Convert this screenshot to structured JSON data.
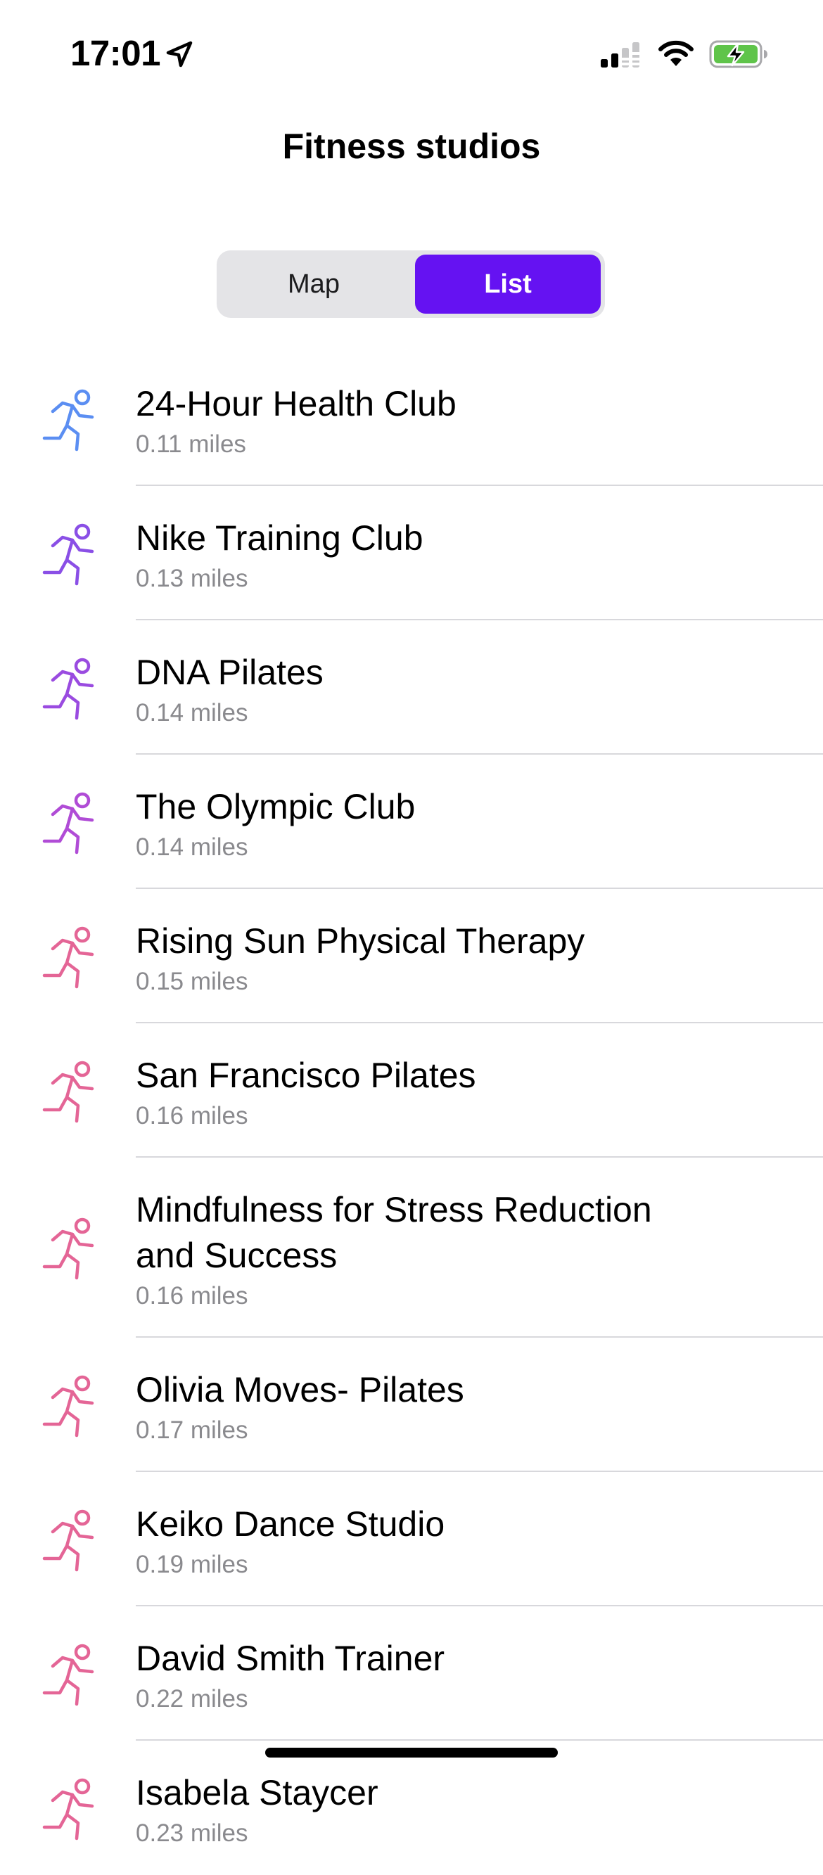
{
  "status_bar": {
    "time": "17:01"
  },
  "header": {
    "title": "Fitness studios"
  },
  "view_toggle": {
    "options": [
      "Map",
      "List"
    ],
    "selected": "List",
    "accent_color": "#6512f2"
  },
  "icon": "figure-run-icon",
  "studios": [
    {
      "name": "24-Hour Health Club",
      "distance": "0.11 miles",
      "icon_color": "#5b8ef2"
    },
    {
      "name": "Nike Training Club",
      "distance": "0.13 miles",
      "icon_color": "#8a4fe6"
    },
    {
      "name": "DNA Pilates",
      "distance": "0.14 miles",
      "icon_color": "#9a4be0"
    },
    {
      "name": "The Olympic Club",
      "distance": "0.14 miles",
      "icon_color": "#b04cd6"
    },
    {
      "name": "Rising Sun Physical Therapy",
      "distance": "0.15 miles",
      "icon_color": "#e46596"
    },
    {
      "name": "San Francisco Pilates",
      "distance": "0.16 miles",
      "icon_color": "#e46596"
    },
    {
      "name": "Mindfulness for Stress Reduction and Success",
      "distance": "0.16 miles",
      "icon_color": "#e46596"
    },
    {
      "name": "Olivia Moves- Pilates",
      "distance": "0.17 miles",
      "icon_color": "#e46596"
    },
    {
      "name": "Keiko Dance Studio",
      "distance": "0.19 miles",
      "icon_color": "#e46596"
    },
    {
      "name": "David Smith Trainer",
      "distance": "0.22 miles",
      "icon_color": "#e46596"
    },
    {
      "name": "Isabela Staycer",
      "distance": "0.23 miles",
      "icon_color": "#e46596"
    }
  ]
}
